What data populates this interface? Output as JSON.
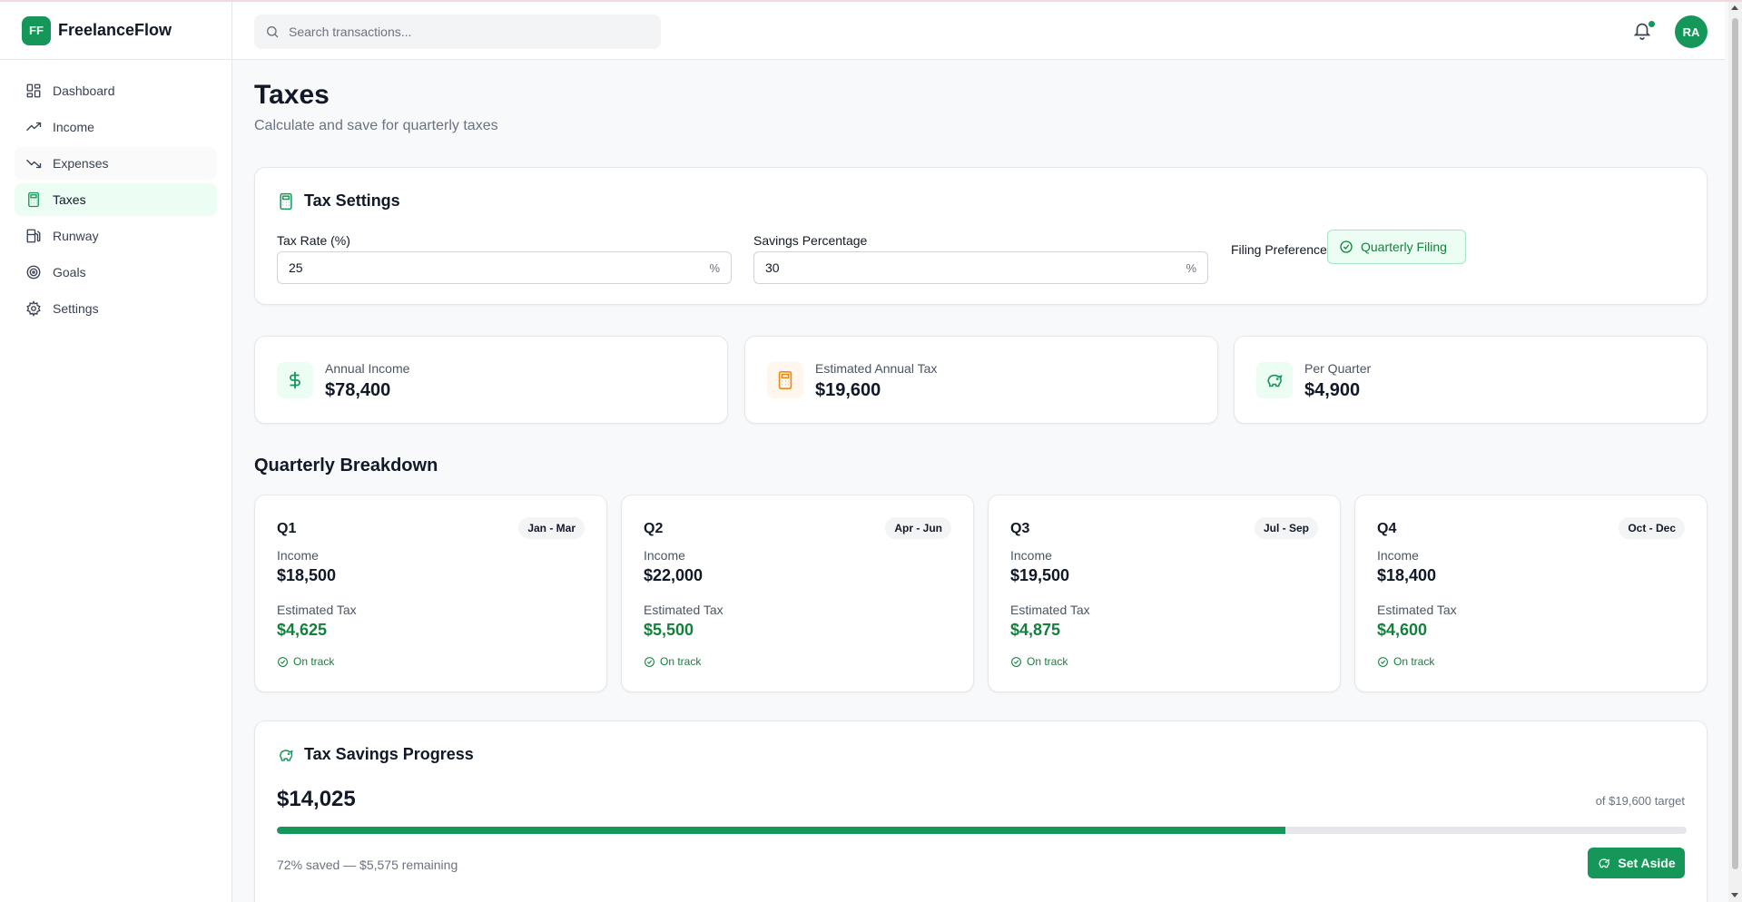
{
  "brand": {
    "logo": "FF",
    "name": "FreelanceFlow",
    "color": "#16975a"
  },
  "sidebar": {
    "items": [
      {
        "label": "Dashboard",
        "icon": "dashboard-icon"
      },
      {
        "label": "Income",
        "icon": "trending-up-icon"
      },
      {
        "label": "Expenses",
        "icon": "trending-down-icon"
      },
      {
        "label": "Taxes",
        "icon": "calculator-icon",
        "active": true
      },
      {
        "label": "Runway",
        "icon": "fuel-icon"
      },
      {
        "label": "Goals",
        "icon": "target-icon"
      },
      {
        "label": "Settings",
        "icon": "gear-icon"
      }
    ]
  },
  "header": {
    "search_placeholder": "Search transactions...",
    "avatar_initials": "RA",
    "notification_icon": "bell-icon"
  },
  "page": {
    "title": "Taxes",
    "subtitle": "Calculate and save for quarterly taxes"
  },
  "tax_settings": {
    "title": "Tax Settings",
    "tax_rate": {
      "label": "Tax Rate (%)",
      "value": "25",
      "suffix": "%"
    },
    "savings_percentage": {
      "label": "Savings Percentage",
      "value": "30",
      "suffix": "%"
    },
    "filing": {
      "label": "Filing Preference",
      "value": "Quarterly Filing"
    }
  },
  "stats": [
    {
      "label": "Annual Income",
      "value": "$78,400",
      "icon": "dollar-icon"
    },
    {
      "label": "Estimated Annual Tax",
      "value": "$19,600",
      "icon": "calculator-icon"
    },
    {
      "label": "Per Quarter",
      "value": "$4,900",
      "icon": "piggy-bank-icon"
    }
  ],
  "breakdown": {
    "title": "Quarterly Breakdown",
    "income_label": "Income",
    "tax_label": "Estimated Tax",
    "quarters": [
      {
        "name": "Q1",
        "range": "Jan - Mar",
        "income": "$18,500",
        "tax": "$4,625",
        "status": "On track"
      },
      {
        "name": "Q2",
        "range": "Apr - Jun",
        "income": "$22,000",
        "tax": "$5,500",
        "status": "On track"
      },
      {
        "name": "Q3",
        "range": "Jul - Sep",
        "income": "$19,500",
        "tax": "$4,875",
        "status": "On track"
      },
      {
        "name": "Q4",
        "range": "Oct - Dec",
        "income": "$18,400",
        "tax": "$4,600",
        "status": "On track"
      }
    ]
  },
  "savings": {
    "title": "Tax Savings Progress",
    "amount": "$14,025",
    "target": "of $19,600 target",
    "progress": 0.7156,
    "note": "72% saved — $5,575 remaining",
    "button": "Set Aside"
  }
}
